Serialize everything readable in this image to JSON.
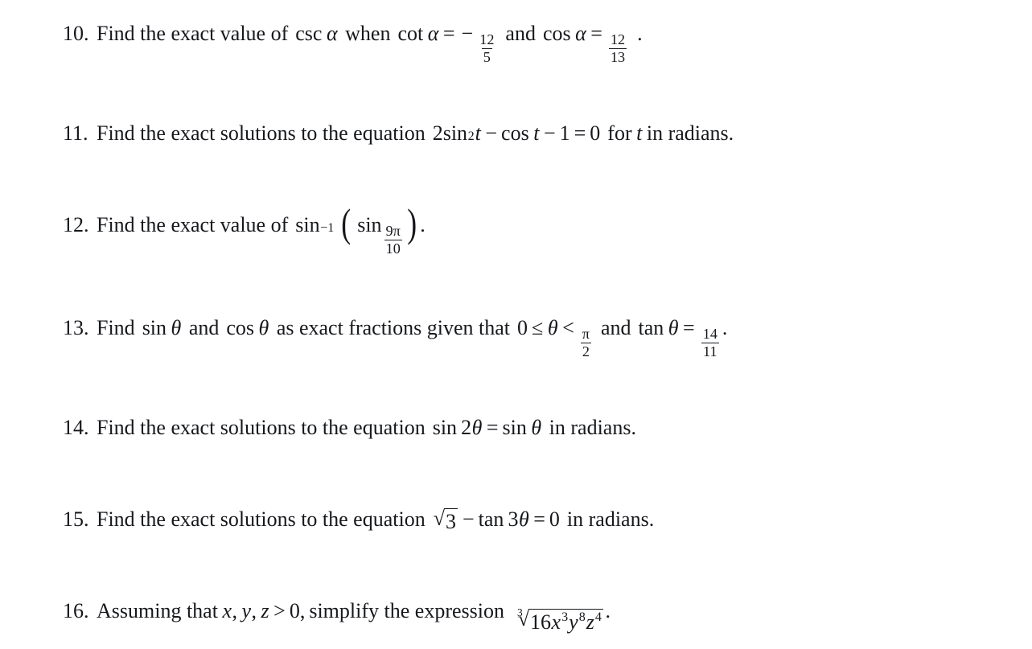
{
  "document": {
    "type": "math-worksheet",
    "background_color": "#ffffff",
    "text_color": "#16181c"
  },
  "problems": [
    {
      "number": "10.",
      "text_plain": "Find the exact value of csc α when cot α = −12/5 and cos α = 12/13 .",
      "lead": "Find the exact value of",
      "fn1": "csc",
      "var1": "α",
      "connector1": "when",
      "fn2": "cot",
      "var2": "α",
      "rel1": "=",
      "sign1": "−",
      "frac1": {
        "num": "12",
        "den": "5"
      },
      "connector2": "and",
      "fn3": "cos",
      "var3": "α",
      "rel2": "=",
      "frac2": {
        "num": "12",
        "den": "13"
      },
      "terminator": "."
    },
    {
      "number": "11.",
      "text_plain": "Find the exact solutions to the equation 2sin²t − cos t − 1 = 0 for t in radians.",
      "lead": "Find the exact solutions to the equation",
      "coef": "2",
      "fn1": "sin",
      "exp1": "2",
      "var1": "t",
      "op1": "−",
      "fn2": "cos",
      "var2": "t",
      "op2": "−",
      "const1": "1",
      "rel1": "=",
      "const2": "0",
      "tail": "for",
      "var3": "t",
      "tail2": "in radians."
    },
    {
      "number": "12.",
      "text_plain": "Find the exact value of sin⁻¹ (sin 9π/10).",
      "lead": "Find the exact value of",
      "fn1": "sin",
      "exp1": "−1",
      "paren_open": "(",
      "fn2": "sin",
      "frac1": {
        "num": "9π",
        "den": "10"
      },
      "paren_close": ")",
      "terminator": "."
    },
    {
      "number": "13.",
      "text_plain": "Find sin θ and cos θ as exact fractions given that 0 ≤ θ < π/2 and tan θ = 14/11.",
      "lead": "Find",
      "fn1": "sin",
      "var1": "θ",
      "connector1": "and",
      "fn2": "cos",
      "var2": "θ",
      "mid": "as exact fractions given that",
      "const1": "0",
      "rel1": "≤",
      "var3": "θ",
      "rel2": "<",
      "frac1": {
        "num": "π",
        "den": "2"
      },
      "connector2": "and",
      "fn3": "tan",
      "var4": "θ",
      "rel3": "=",
      "frac2": {
        "num": "14",
        "den": "11"
      },
      "terminator": "."
    },
    {
      "number": "14.",
      "text_plain": "Find the exact solutions to the equation sin 2θ = sin θ in radians.",
      "lead": "Find the exact solutions to the equation",
      "fn1": "sin",
      "coef1": "2",
      "var1": "θ",
      "rel1": "=",
      "fn2": "sin",
      "var2": "θ",
      "tail": "in radians."
    },
    {
      "number": "15.",
      "text_plain": "Find the exact solutions to the equation √3 − tan 3θ = 0 in radians.",
      "lead": "Find the exact solutions to the equation",
      "radicand1": "3",
      "op1": "−",
      "fn1": "tan",
      "coef1": "3",
      "var1": "θ",
      "rel1": "=",
      "const1": "0",
      "tail": "in radians."
    },
    {
      "number": "16.",
      "text_plain": "Assuming that x, y, z > 0, simplify the expression ∛(16x³y⁸z⁴).",
      "lead": "Assuming that",
      "var1": "x",
      "comma1": ",",
      "var2": "y",
      "comma2": ",",
      "var3": "z",
      "rel1": ">",
      "const1": "0,",
      "mid": "simplify the expression",
      "root_index": "3",
      "radicand_coef": "16",
      "rv1": "x",
      "re1": "3",
      "rv2": "y",
      "re2": "8",
      "rv3": "z",
      "re3": "4",
      "terminator": "."
    }
  ]
}
